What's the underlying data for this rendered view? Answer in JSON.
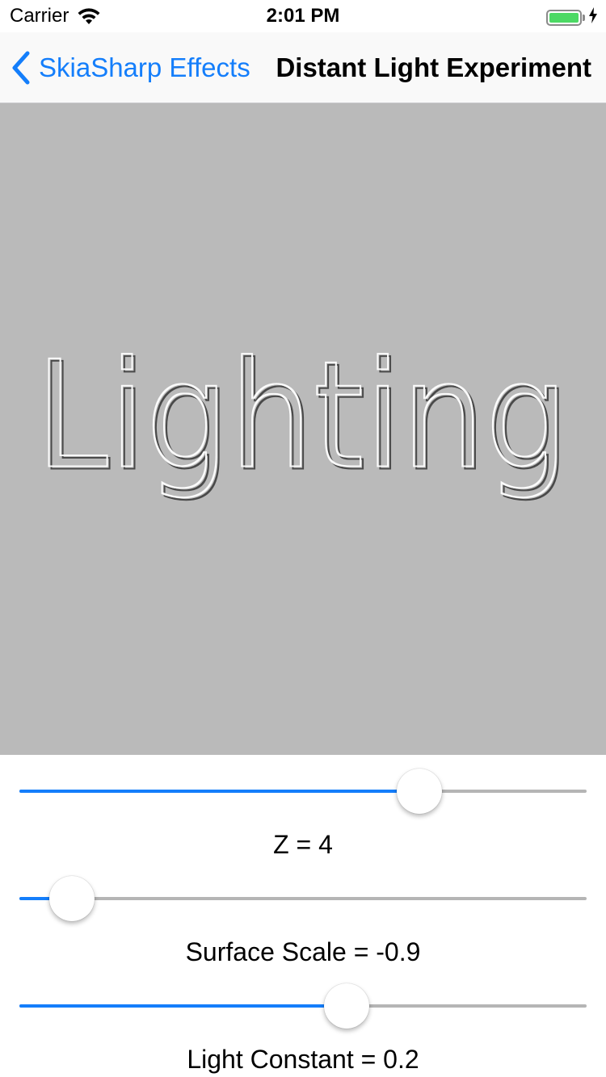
{
  "status_bar": {
    "carrier": "Carrier",
    "time": "2:01 PM",
    "battery_color": "#4cd964"
  },
  "nav": {
    "back_label": "SkiaSharp Effects",
    "title": "Distant Light Experiment",
    "accent_color": "#147efb"
  },
  "canvas": {
    "text": "Lighting",
    "background_color": "#bababa"
  },
  "controls": {
    "slider_color": "#147efb",
    "z": {
      "label": "Z = 4",
      "fraction": 0.705
    },
    "surface_scale": {
      "label": "Surface Scale = -0.9",
      "fraction": 0.093
    },
    "light_constant": {
      "label": "Light Constant = 0.2",
      "fraction": 0.577
    }
  }
}
